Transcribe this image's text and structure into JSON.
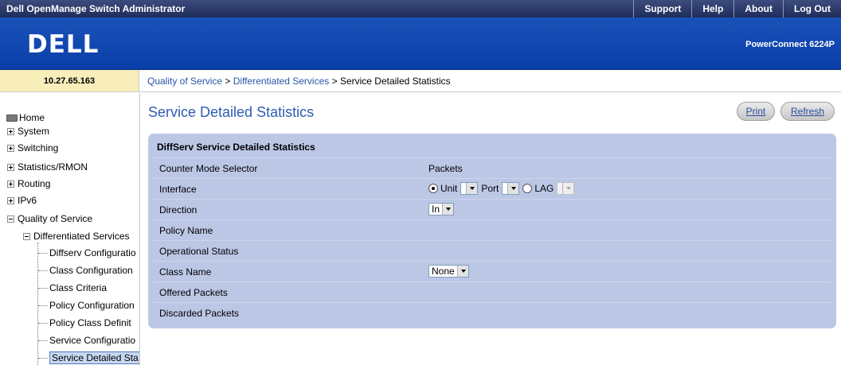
{
  "app": {
    "title": "Dell OpenManage Switch Administrator",
    "top_nav": [
      "Support",
      "Help",
      "About",
      "Log Out"
    ],
    "logo_text": "DELL",
    "model": "PowerConnect 6224P",
    "ip_address": "10.27.65.163"
  },
  "breadcrumb": {
    "items": [
      "Quality of Service",
      "Differentiated Services"
    ],
    "separator": " > ",
    "current": "Service Detailed Statistics"
  },
  "sidebar": {
    "home": "Home",
    "top_items": [
      "System",
      "Switching",
      "Statistics/RMON",
      "Routing",
      "IPv6",
      "Quality of Service"
    ],
    "sub_item": "Differentiated Services",
    "leaves": [
      "Diffserv Configuratio",
      "Class Configuration",
      "Class Criteria",
      "Policy Configuration",
      "Policy Class Definit",
      "Service Configuratio",
      "Service Detailed Sta"
    ]
  },
  "page": {
    "title": "Service Detailed Statistics",
    "print_label": "Print",
    "refresh_label": "Refresh"
  },
  "panel": {
    "heading": "DiffServ Service Detailed Statistics",
    "counter_mode": {
      "label": "Counter Mode Selector",
      "value": "Packets"
    },
    "interface": {
      "label": "Interface",
      "unit_label": "Unit",
      "port_label": "Port",
      "lag_label": "LAG",
      "unit_value": "",
      "port_value": "",
      "lag_value": "",
      "selected": "Unit"
    },
    "direction": {
      "label": "Direction",
      "value": "In"
    },
    "policy_name": {
      "label": "Policy Name",
      "value": ""
    },
    "operational_status": {
      "label": "Operational Status",
      "value": ""
    },
    "class_name": {
      "label": "Class Name",
      "value": "None"
    },
    "offered_packets": {
      "label": "Offered Packets",
      "value": ""
    },
    "discarded_packets": {
      "label": "Discarded Packets",
      "value": ""
    }
  },
  "colors": {
    "banner": "#1a52b9",
    "topbar": "#2a386a",
    "title_blue": "#2e5db2",
    "panel": "#bcc7e6",
    "ip_bar": "#f7eeba"
  }
}
